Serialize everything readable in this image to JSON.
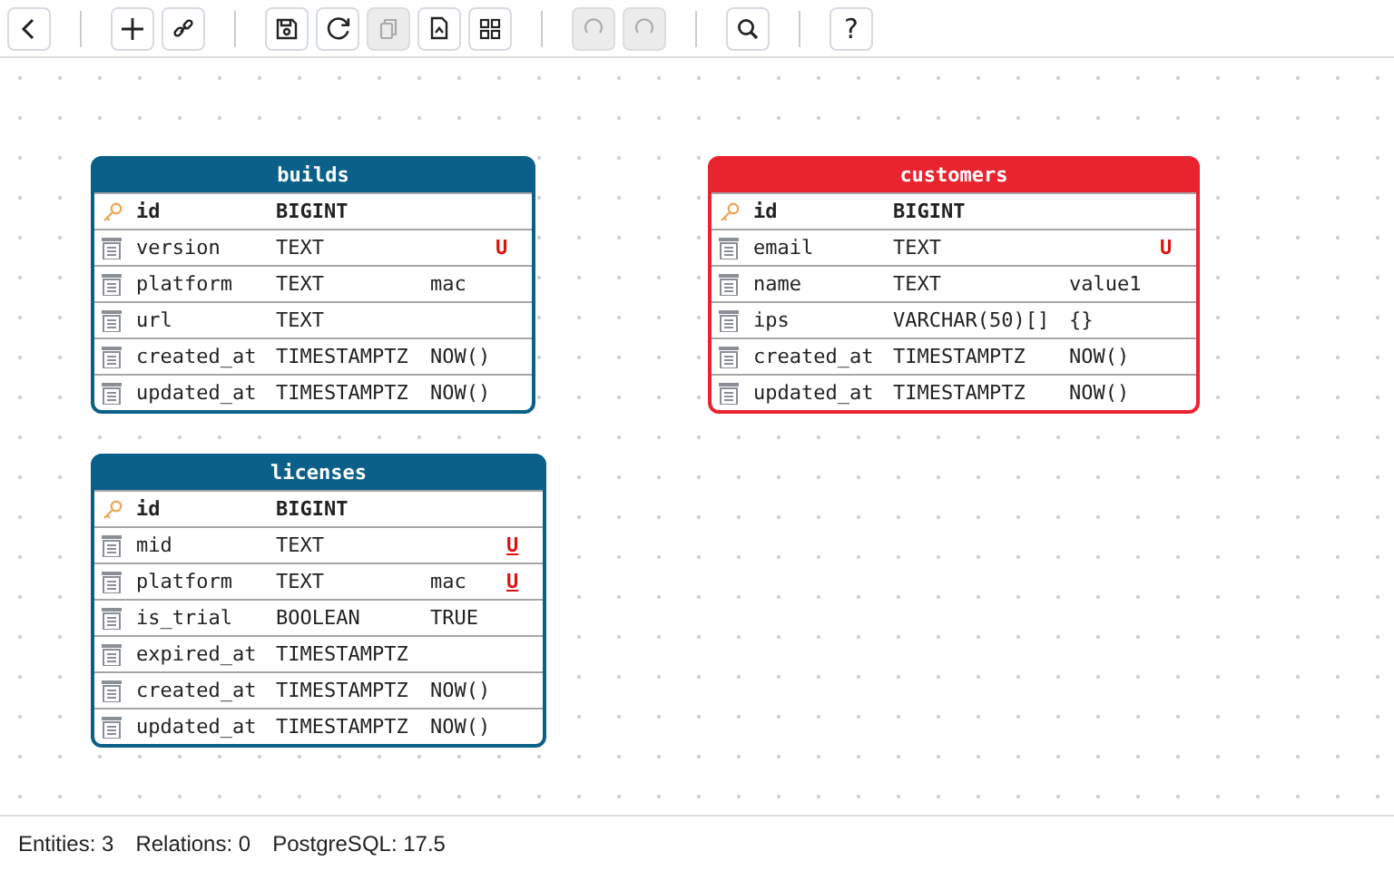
{
  "toolbar": {
    "groups": [
      [
        {
          "kind": "back",
          "disabled": false
        }
      ],
      [
        {
          "kind": "add",
          "disabled": false
        },
        {
          "kind": "link",
          "disabled": false
        }
      ],
      [
        {
          "kind": "save",
          "disabled": false
        },
        {
          "kind": "refresh",
          "disabled": false
        },
        {
          "kind": "copy",
          "disabled": true
        },
        {
          "kind": "export",
          "disabled": false
        },
        {
          "kind": "grid",
          "disabled": false
        }
      ],
      [
        {
          "kind": "undo",
          "disabled": true
        },
        {
          "kind": "redo",
          "disabled": true
        }
      ],
      [
        {
          "kind": "search",
          "disabled": false
        }
      ],
      [
        {
          "kind": "help",
          "disabled": false,
          "label": "?"
        }
      ]
    ]
  },
  "entities": [
    {
      "name": "builds",
      "color": "#0b6089",
      "columns": [
        {
          "kind": "primary",
          "name": "id",
          "type": "BIGINT"
        },
        {
          "kind": "column",
          "name": "version",
          "type": "TEXT",
          "flag": "U",
          "flag_underlined": false
        },
        {
          "kind": "column",
          "name": "platform",
          "type": "TEXT",
          "default": "mac"
        },
        {
          "kind": "column",
          "name": "url",
          "type": "TEXT"
        },
        {
          "kind": "column",
          "name": "created_at",
          "type": "TIMESTAMPTZ",
          "default": "NOW()"
        },
        {
          "kind": "column",
          "name": "updated_at",
          "type": "TIMESTAMPTZ",
          "default": "NOW()"
        }
      ]
    },
    {
      "name": "licenses",
      "color": "#0b6089",
      "columns": [
        {
          "kind": "primary",
          "name": "id",
          "type": "BIGINT"
        },
        {
          "kind": "column",
          "name": "mid",
          "type": "TEXT",
          "flag": "U",
          "flag_underlined": true
        },
        {
          "kind": "column",
          "name": "platform",
          "type": "TEXT",
          "default": "mac",
          "flag": "U",
          "flag_underlined": true
        },
        {
          "kind": "column",
          "name": "is_trial",
          "type": "BOOLEAN",
          "default": "TRUE"
        },
        {
          "kind": "column",
          "name": "expired_at",
          "type": "TIMESTAMPTZ"
        },
        {
          "kind": "column",
          "name": "created_at",
          "type": "TIMESTAMPTZ",
          "default": "NOW()"
        },
        {
          "kind": "column",
          "name": "updated_at",
          "type": "TIMESTAMPTZ",
          "default": "NOW()"
        }
      ]
    },
    {
      "name": "customers",
      "color": "#e8242f",
      "columns": [
        {
          "kind": "primary",
          "name": "id",
          "type": "BIGINT"
        },
        {
          "kind": "column",
          "name": "email",
          "type": "TEXT",
          "flag": "U",
          "flag_underlined": false
        },
        {
          "kind": "column",
          "name": "name",
          "type": "TEXT",
          "default": "value1"
        },
        {
          "kind": "column",
          "name": "ips",
          "type": "VARCHAR(50)[]",
          "default": "{}"
        },
        {
          "kind": "column",
          "name": "created_at",
          "type": "TIMESTAMPTZ",
          "default": "NOW()"
        },
        {
          "kind": "column",
          "name": "updated_at",
          "type": "TIMESTAMPTZ",
          "default": "NOW()"
        }
      ]
    }
  ],
  "status_bar": [
    "Entities: 3",
    "Relations: 0",
    "PostgreSQL: 17.5"
  ]
}
